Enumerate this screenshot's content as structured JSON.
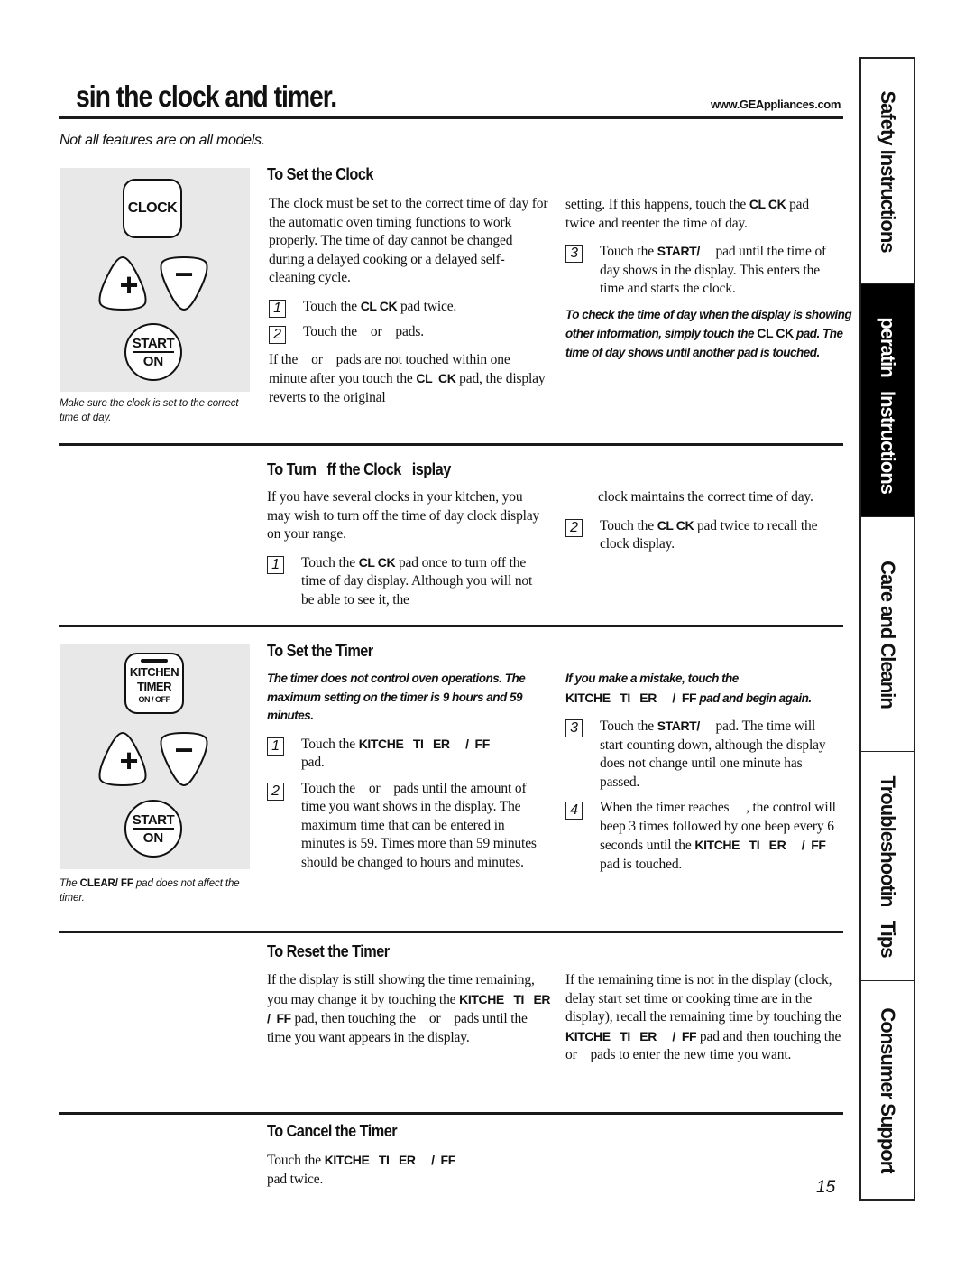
{
  "header": {
    "title": "sin   the clock and timer.",
    "website": "www.GEAppliances.com",
    "subtitle": "Not all features are on all models."
  },
  "keypad_clock": {
    "clock_key": "CLOCK",
    "plus_key": "+",
    "minus_key": "−",
    "start_key_top": "START",
    "start_key_bottom": "ON",
    "caption": "Make sure the clock is set to the correct time of day."
  },
  "keypad_timer": {
    "timer_key_line1": "KITCHEN",
    "timer_key_line2": "TIMER",
    "timer_key_line3": "ON / OFF",
    "plus_key": "+",
    "minus_key": "−",
    "start_key_top": "START",
    "start_key_bottom": "ON",
    "caption_pre": "The ",
    "caption_bold": "CLEAR/  FF",
    "caption_post": " pad does not affect the timer."
  },
  "set_clock": {
    "heading": "To Set the Clock",
    "intro": "The clock must be set to the correct time of day for the automatic oven timing functions to work properly. The time of day cannot be changed during a delayed cooking or a delayed self-cleaning cycle.",
    "step1": {
      "num": "1",
      "pre": "Touch the ",
      "bold": "CL  CK",
      "post": " pad twice."
    },
    "step2": {
      "num": "2",
      "text": "Touch the    or    pads."
    },
    "note_pre": "If the    or    pads are not touched within one minute after you touch the ",
    "note_bold": "CL  CK",
    "note_post": " pad, the display reverts to the original",
    "cont_pre": "setting. If this happens, touch the ",
    "cont_bold": "CL  CK",
    "cont_post": " pad twice and reenter the time of day.",
    "step3": {
      "num": "3",
      "pre": "Touch the ",
      "bold": "START/    ",
      "post": " pad until the time of day shows in the display. This enters the time and starts the clock."
    },
    "tip_pre": "To check the time of day when the display is showing other information, simply touch the ",
    "tip_bold": "CL  CK",
    "tip_post": " pad. The time of day shows until another pad is touched."
  },
  "turn_off_clock": {
    "heading": "To Turn   ff the Clock   isplay",
    "intro": "If you have several clocks in your kitchen, you may wish to turn off the time of day clock display on your range.",
    "step1": {
      "num": "1",
      "pre": "Touch the ",
      "bold": "CL  CK",
      "post": " pad once to turn off the time of day display. Although you will not be able to see it, the"
    },
    "cont": "clock maintains the correct time of day.",
    "step2": {
      "num": "2",
      "pre": "Touch the ",
      "bold": "CL  CK",
      "post": " pad twice to recall the clock display."
    }
  },
  "set_timer": {
    "heading": "To Set the Timer",
    "note": "The timer does not control oven operations. The maximum setting on the timer is 9 hours and 59 minutes.",
    "step1": {
      "num": "1",
      "pre": "Touch the ",
      "bold": "KITCHE   TI   ER     /  FF",
      "post": " pad."
    },
    "step2": {
      "num": "2",
      "text": "Touch the    or    pads until the amount of time you want shows in the display. The maximum time that can be entered in minutes is 59. Times more than 59 minutes should be changed to hours and minutes."
    },
    "mistake_pre": "If you make a mistake, touch the ",
    "mistake_bold": "KITCHE   TI   ER     /  FF",
    "mistake_post": " pad and begin again.",
    "step3": {
      "num": "3",
      "pre": "Touch the ",
      "bold": "START/    ",
      "post": " pad. The time will start counting down, although the display does not change until one minute has passed."
    },
    "step4": {
      "num": "4",
      "pre": "When the timer reaches     , the control will beep 3 times followed by one beep every 6 seconds until the ",
      "bold": "KITCHE   TI   ER     /  FF",
      "post": " pad is touched."
    }
  },
  "reset_timer": {
    "heading": "To Reset the Timer",
    "col1_pre": "If the display is still showing the time remaining, you may change it by touching the ",
    "col1_bold": "KITCHE   TI   ER     /  FF",
    "col1_post": " pad, then touching the    or    pads until the time you want appears in the display.",
    "col2_pre": "If the remaining time is not in the display (clock, delay start set time or cooking time are in the display), recall the remaining time by touching the ",
    "col2_bold": "KITCHE   TI   ER     /  FF",
    "col2_post": " pad and then touching the    or    pads to enter the new time you want."
  },
  "cancel_timer": {
    "heading": "To Cancel the Timer",
    "pre": "Touch the ",
    "bold": "KITCHE   TI   ER     /  FF",
    "post": " pad twice."
  },
  "side_tabs": [
    {
      "label": "Safety Instructions",
      "active": false
    },
    {
      "label": "  peratin   Instructions",
      "active": true
    },
    {
      "label": "Care and Cleanin",
      "active": false
    },
    {
      "label": "Troubleshootin   Tips",
      "active": false
    },
    {
      "label": "Consumer Support",
      "active": false
    }
  ],
  "page_number": "15"
}
